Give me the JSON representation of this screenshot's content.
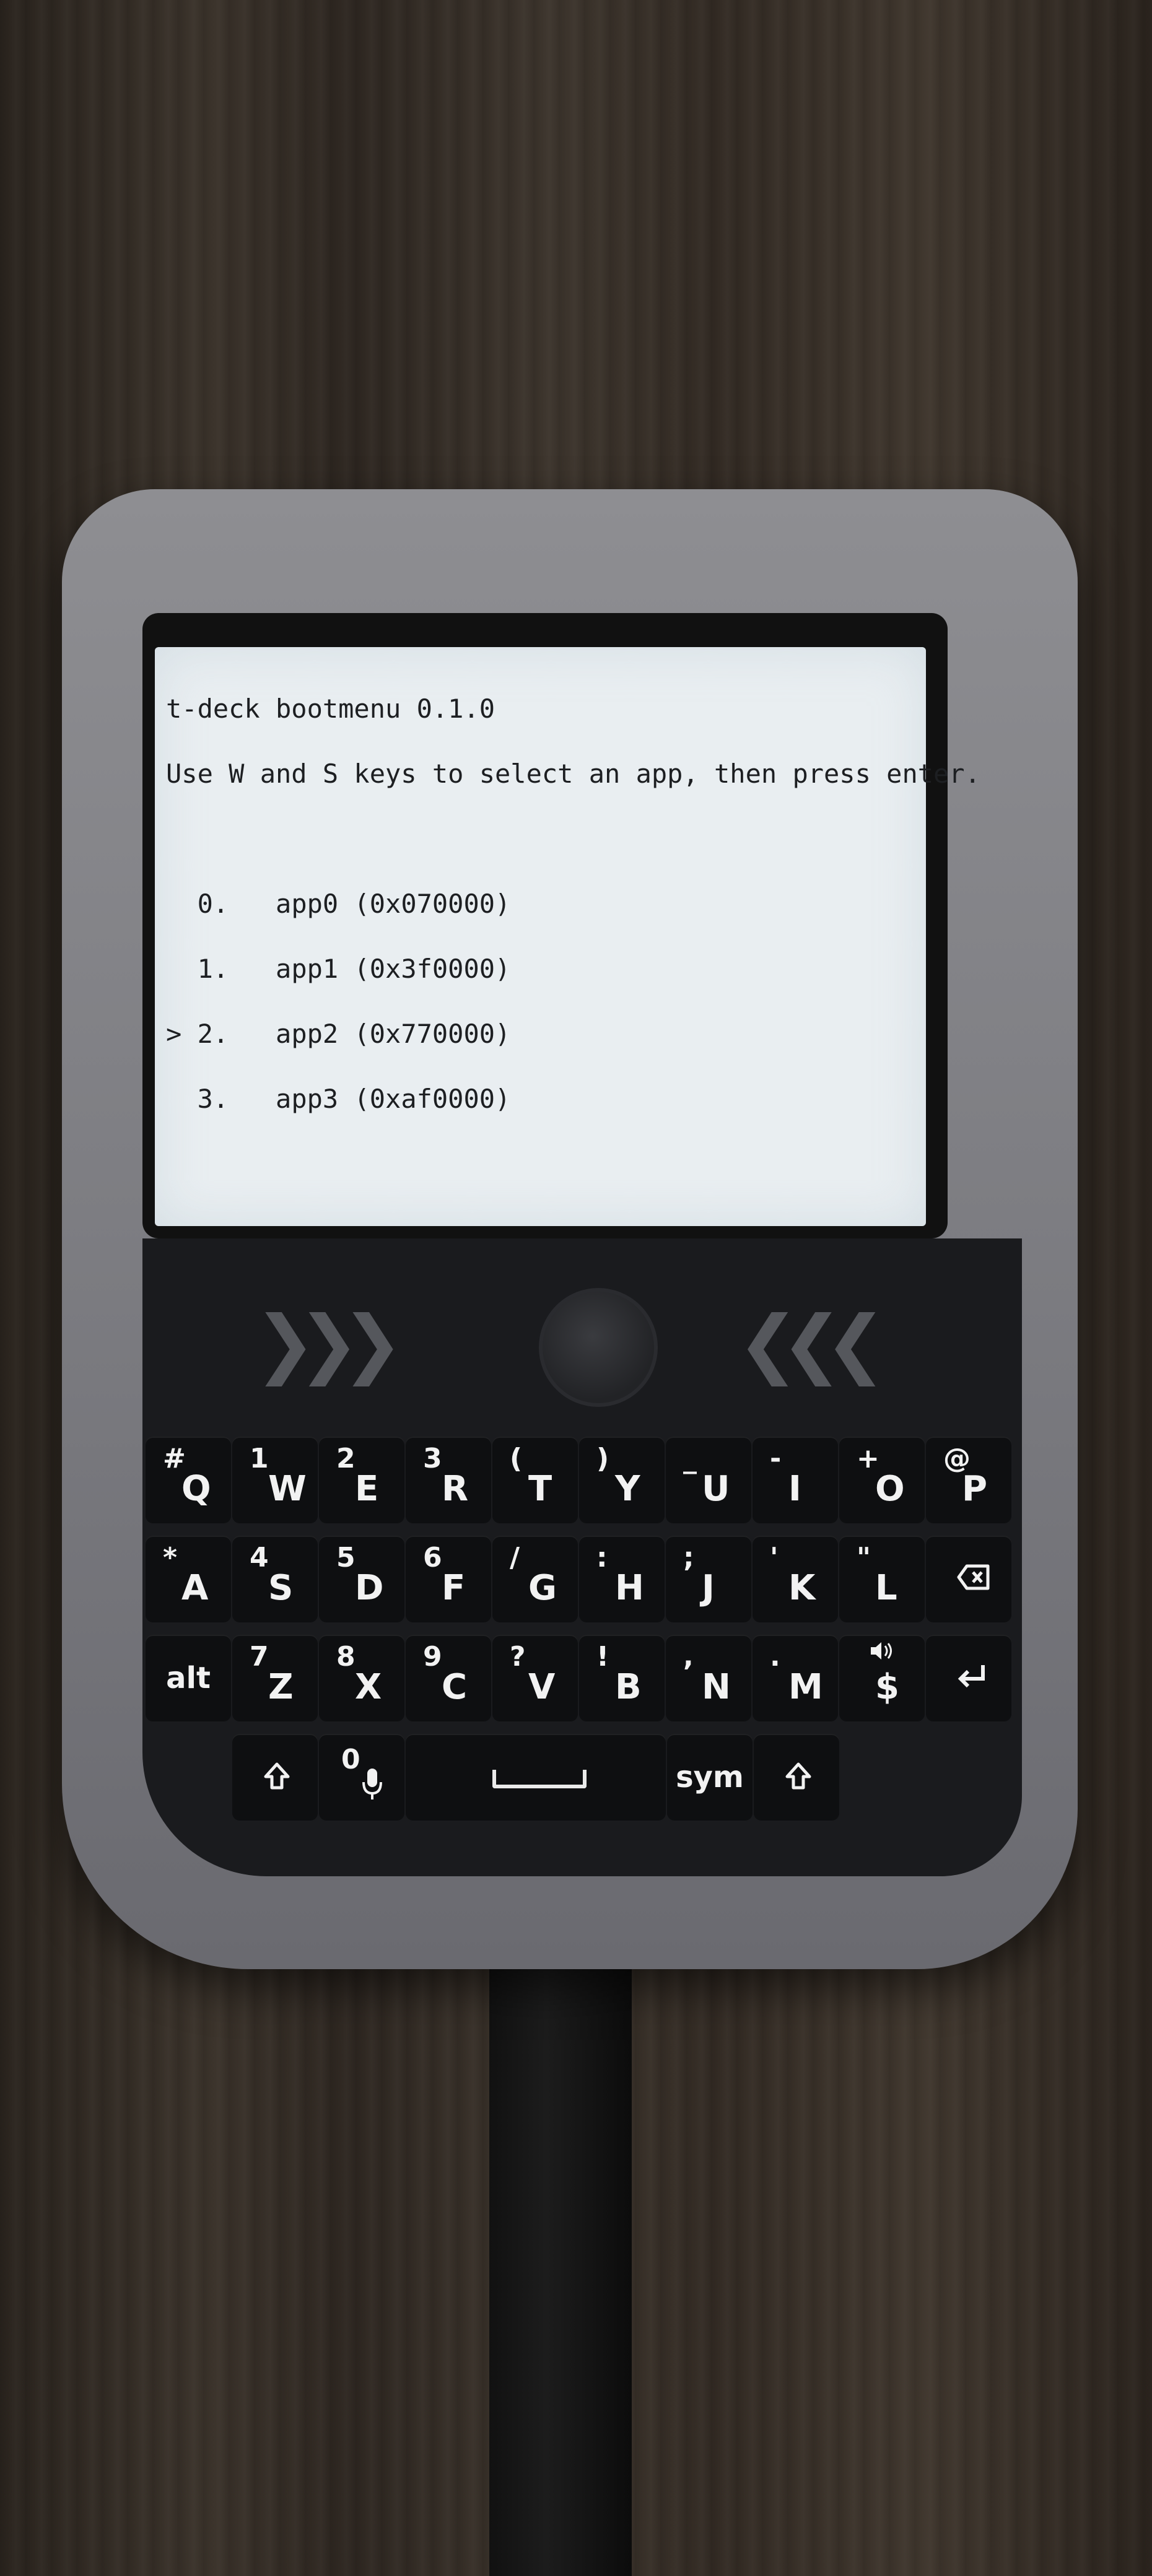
{
  "screen": {
    "lines": [
      "t-deck bootmenu 0.1.0",
      "Use W and S keys to select an app, then press enter."
    ],
    "menu": [
      {
        "marker": " ",
        "index": "0.",
        "label": "app0 (0x070000)"
      },
      {
        "marker": " ",
        "index": "1.",
        "label": "app1 (0x3f0000)"
      },
      {
        "marker": ">",
        "index": "2.",
        "label": "app2 (0x770000)"
      },
      {
        "marker": " ",
        "index": "3.",
        "label": "app3 (0xaf0000)"
      }
    ]
  },
  "keyboard": {
    "row1": [
      {
        "sec": "#",
        "pri": "Q"
      },
      {
        "sec": "1",
        "pri": "W"
      },
      {
        "sec": "2",
        "pri": "E"
      },
      {
        "sec": "3",
        "pri": "R"
      },
      {
        "sec": "(",
        "pri": "T"
      },
      {
        "sec": ")",
        "pri": "Y"
      },
      {
        "sec": "_",
        "pri": "U"
      },
      {
        "sec": "-",
        "pri": "I"
      },
      {
        "sec": "+",
        "pri": "O"
      },
      {
        "sec": "@",
        "pri": "P"
      }
    ],
    "row2": [
      {
        "sec": "*",
        "pri": "A"
      },
      {
        "sec": "4",
        "pri": "S"
      },
      {
        "sec": "5",
        "pri": "D"
      },
      {
        "sec": "6",
        "pri": "F"
      },
      {
        "sec": "/",
        "pri": "G"
      },
      {
        "sec": ":",
        "pri": "H"
      },
      {
        "sec": ";",
        "pri": "J"
      },
      {
        "sec": "'",
        "pri": "K"
      },
      {
        "sec": "\"",
        "pri": "L"
      }
    ],
    "row3": [
      {
        "sec": "7",
        "pri": "Z"
      },
      {
        "sec": "8",
        "pri": "X"
      },
      {
        "sec": "9",
        "pri": "C"
      },
      {
        "sec": "?",
        "pri": "V"
      },
      {
        "sec": "!",
        "pri": "B"
      },
      {
        "sec": ",",
        "pri": "N"
      },
      {
        "sec": ".",
        "pri": "M"
      },
      {
        "sec": "",
        "pri": "$"
      }
    ],
    "alt_label": "alt",
    "zero_label": "0",
    "sym_label": "sym",
    "icons": [
      "backspace-icon",
      "enter-icon",
      "shift-icon",
      "microphone-icon",
      "speaker-icon",
      "space-icon"
    ]
  },
  "colors": {
    "screen_bg": "#e9eef1",
    "screen_text": "#1d1f22",
    "case": "#7f7f84",
    "key": "#0e0f11"
  }
}
